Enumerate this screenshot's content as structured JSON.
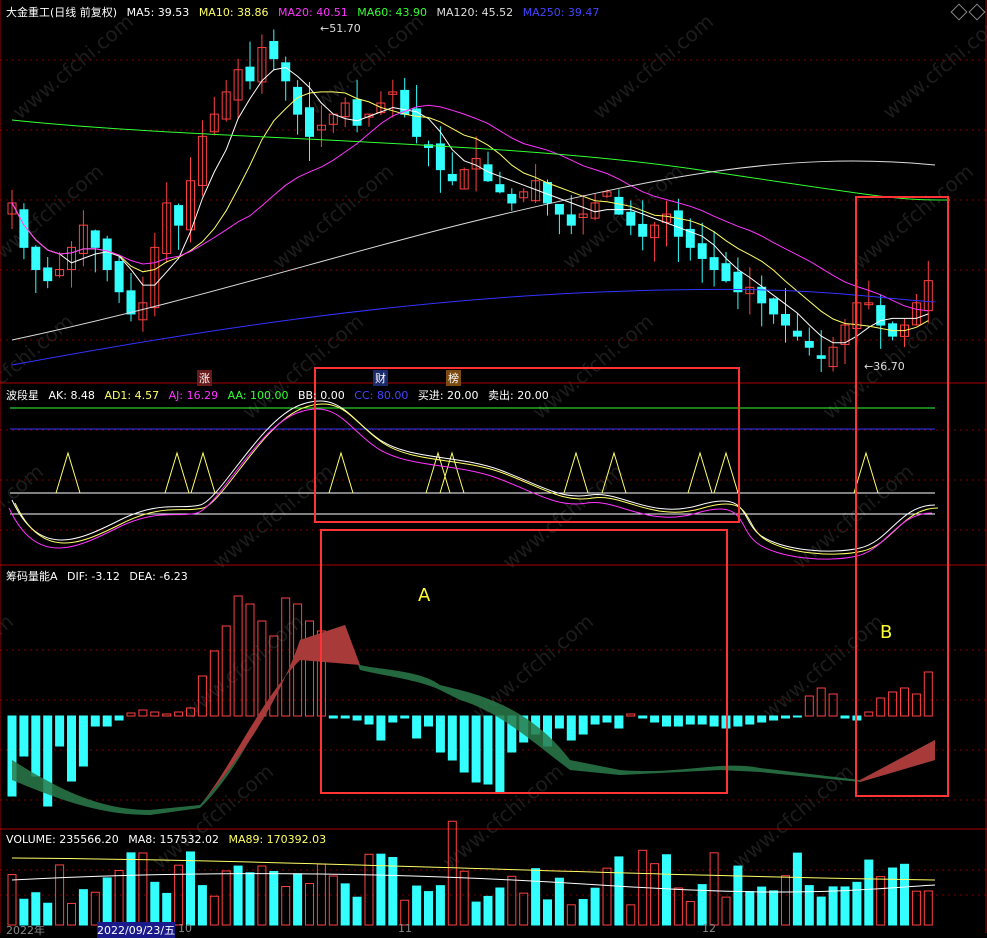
{
  "colors": {
    "up": "#ff4040",
    "down": "#33ffff",
    "ma5": "#ffffff",
    "ma10": "#ffff66",
    "ma20": "#ff33ff",
    "ma60": "#33ff33",
    "ma120": "#dddddd",
    "ma250": "#3333ff",
    "grid": "#7a0000",
    "box": "#ff3333"
  },
  "panel1": {
    "title": "大金重工(日线 前复权)",
    "items": [
      {
        "text": "MA5: 39.53",
        "color": "#ffffff"
      },
      {
        "text": "MA10: 38.86",
        "color": "#ffff66"
      },
      {
        "text": "MA20: 40.51",
        "color": "#ff33ff"
      },
      {
        "text": "MA60: 43.90",
        "color": "#33ff33"
      },
      {
        "text": "MA120: 45.52",
        "color": "#dddddd"
      },
      {
        "text": "MA250: 39.47",
        "color": "#3333ff"
      }
    ],
    "high_label": "51.70",
    "low_label": "36.70",
    "tags": {
      "zhang": "涨",
      "cai": "财",
      "bang": "榜"
    }
  },
  "panel2": {
    "title": "波段星",
    "items": [
      {
        "text": "AK: 8.48",
        "color": "#ffffff"
      },
      {
        "text": "AD1: 4.57",
        "color": "#ffff66"
      },
      {
        "text": "AJ: 16.29",
        "color": "#ff33ff"
      },
      {
        "text": "AA: 100.00",
        "color": "#33ff33"
      },
      {
        "text": "BB: 0.00",
        "color": "#ffffff"
      },
      {
        "text": "CC: 80.00",
        "color": "#3333ff"
      },
      {
        "text": "买进: 20.00",
        "color": "#ffffff"
      },
      {
        "text": "卖出: 20.00",
        "color": "#ffffff"
      }
    ]
  },
  "panel3": {
    "title": "筹码量能A",
    "items": [
      {
        "text": "DIF: -3.12",
        "color": "#ffffff"
      },
      {
        "text": "DEA: -6.23",
        "color": "#ffffff"
      }
    ],
    "label_a": "A",
    "label_b": "B"
  },
  "panel4": {
    "title": "VOLUME: 235566.20",
    "items": [
      {
        "text": "MA8: 157532.02",
        "color": "#ffffff"
      },
      {
        "text": "MA89: 170392.03",
        "color": "#ffff66"
      }
    ]
  },
  "xaxis": {
    "left_label": "2022年",
    "date_label": "2022/09/23/五",
    "m10": "10",
    "m11": "11",
    "m12": "12"
  },
  "watermark": "www.cfchi.com"
}
